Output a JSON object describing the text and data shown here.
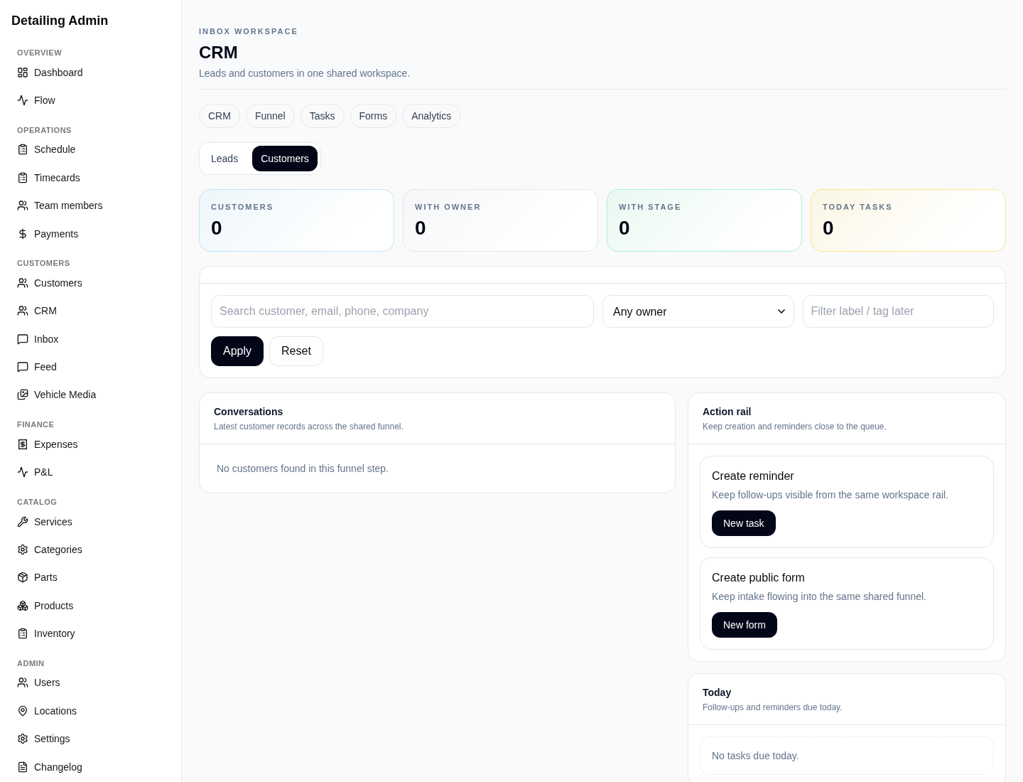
{
  "sidebar": {
    "title": "Detailing Admin",
    "sections": [
      {
        "heading": "OVERVIEW",
        "items": [
          {
            "label": "Dashboard"
          },
          {
            "label": "Flow"
          }
        ]
      },
      {
        "heading": "OPERATIONS",
        "items": [
          {
            "label": "Schedule"
          },
          {
            "label": "Timecards"
          },
          {
            "label": "Team members"
          },
          {
            "label": "Payments"
          }
        ]
      },
      {
        "heading": "CUSTOMERS",
        "items": [
          {
            "label": "Customers"
          },
          {
            "label": "CRM"
          },
          {
            "label": "Inbox"
          },
          {
            "label": "Feed"
          },
          {
            "label": "Vehicle Media"
          }
        ]
      },
      {
        "heading": "FINANCE",
        "items": [
          {
            "label": "Expenses"
          },
          {
            "label": "P&L"
          }
        ]
      },
      {
        "heading": "CATALOG",
        "items": [
          {
            "label": "Services"
          },
          {
            "label": "Categories"
          },
          {
            "label": "Parts"
          },
          {
            "label": "Products"
          },
          {
            "label": "Inventory"
          }
        ]
      },
      {
        "heading": "ADMIN",
        "items": [
          {
            "label": "Users"
          },
          {
            "label": "Locations"
          },
          {
            "label": "Settings"
          },
          {
            "label": "Changelog"
          }
        ]
      }
    ]
  },
  "header": {
    "kicker": "INBOX WORKSPACE",
    "title": "CRM",
    "subtitle": "Leads and customers in one shared workspace."
  },
  "nav_tabs": [
    "CRM",
    "Funnel",
    "Tasks",
    "Forms",
    "Analytics"
  ],
  "segmented": [
    {
      "label": "Leads",
      "selected": false
    },
    {
      "label": "Customers",
      "selected": true
    }
  ],
  "stats": [
    {
      "label": "CUSTOMERS",
      "value": "0",
      "color": "#bae6fd"
    },
    {
      "label": "WITH OWNER",
      "value": "0",
      "color": "#e2e8f0"
    },
    {
      "label": "WITH STAGE",
      "value": "0",
      "color": "#a7f3d0"
    },
    {
      "label": "TODAY TASKS",
      "value": "0",
      "color": "#fde68a"
    }
  ],
  "filters": {
    "search": {
      "placeholder": "Search customer, email, phone, company"
    },
    "owner": {
      "value": "Any owner"
    },
    "label_filter": {
      "placeholder": "Filter label / tag later"
    },
    "buttons": [
      {
        "label": "Apply",
        "kind": "primary"
      },
      {
        "label": "Reset",
        "kind": "secondary"
      }
    ]
  },
  "conversations": {
    "title": "Conversations",
    "subtitle": "Latest customer records across the shared funnel.",
    "empty": "No customers found in this funnel step."
  },
  "action_rail": {
    "title": "Action rail",
    "subtitle": "Keep creation and reminders close to the queue.",
    "cards": [
      {
        "title": "Create reminder",
        "description": "Keep follow-ups visible from the same workspace rail.",
        "button": "New task"
      },
      {
        "title": "Create public form",
        "description": "Keep intake flowing into the same shared funnel.",
        "button": "New form"
      }
    ]
  },
  "today": {
    "title": "Today",
    "subtitle": "Follow-ups and reminders due today.",
    "empty": "No tasks due today."
  }
}
